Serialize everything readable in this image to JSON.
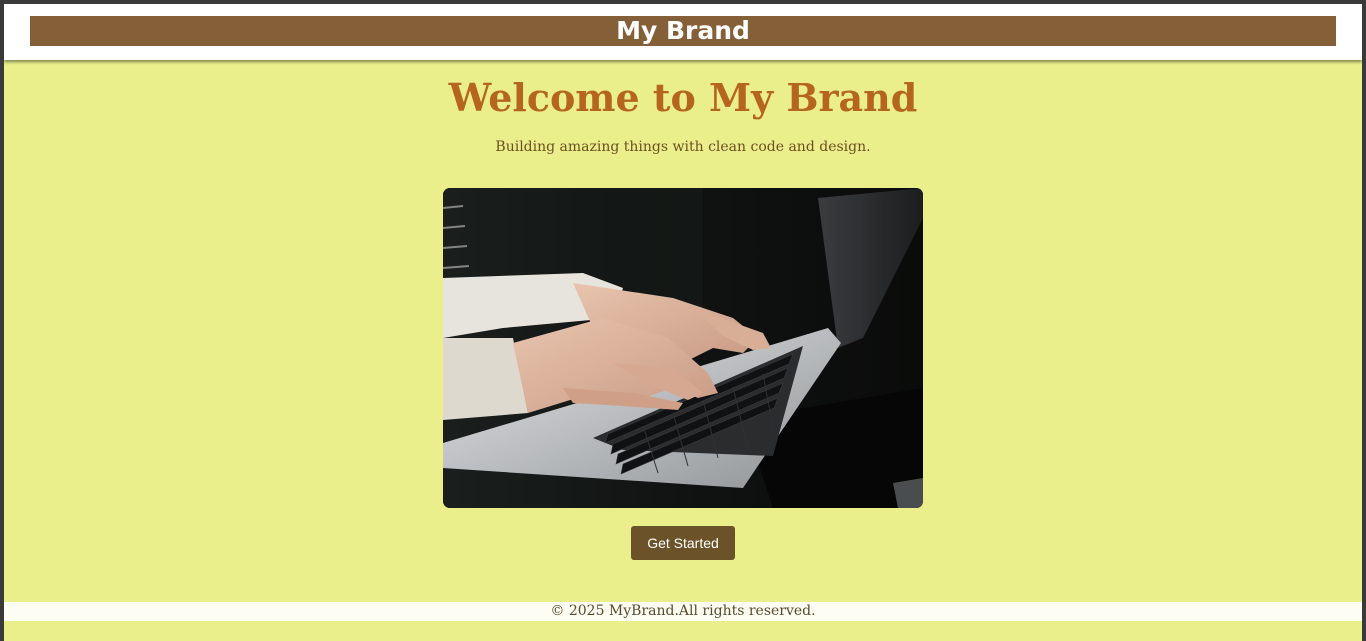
{
  "header": {
    "brand": "My Brand"
  },
  "hero": {
    "title": "Welcome to My Brand",
    "subtitle": "Building amazing things with clean code and design.",
    "image_alt": "Hands typing on a laptop keyboard",
    "cta_label": "Get Started"
  },
  "footer": {
    "text": "© 2025 MyBrand.All rights reserved."
  },
  "colors": {
    "page_background": "#eaef8c",
    "brand_bar": "#845f38",
    "title": "#b5651d",
    "button": "#6b5229"
  }
}
